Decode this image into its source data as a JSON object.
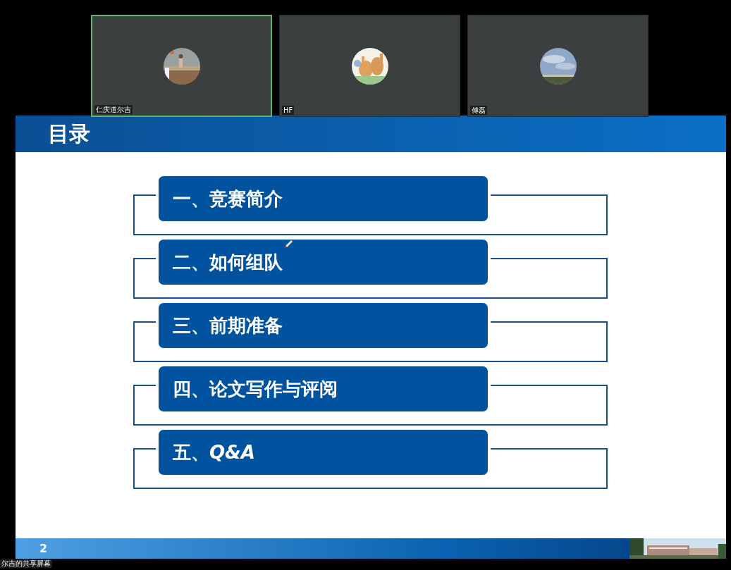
{
  "participants": [
    {
      "name": "仁庆道尔吉",
      "speaking": true,
      "kind": "beach"
    },
    {
      "name": "HF",
      "speaking": false,
      "kind": "cartoon"
    },
    {
      "name": "傅磊",
      "speaking": false,
      "kind": "sky"
    }
  ],
  "slide": {
    "title": "目录",
    "items": [
      {
        "text": "一、竞赛简介",
        "pen_cursor": false
      },
      {
        "text": "二、如何组队",
        "pen_cursor": true
      },
      {
        "text": "三、前期准备",
        "pen_cursor": false
      },
      {
        "text": "四、论文写作与评阅",
        "pen_cursor": false
      },
      {
        "text": "五、*Q&A*",
        "pen_cursor": false
      }
    ],
    "page_number": "2"
  },
  "share_label": "尔吉的共享屏幕"
}
